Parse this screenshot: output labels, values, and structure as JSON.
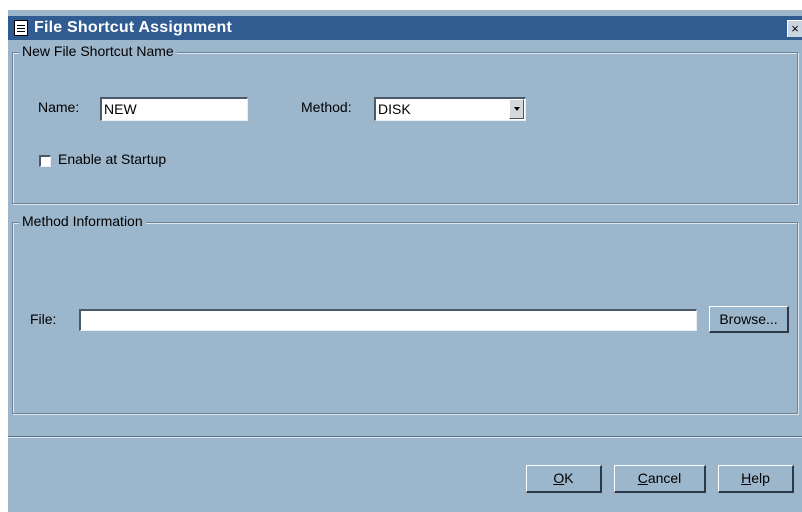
{
  "window": {
    "title": "File Shortcut Assignment",
    "close_label": "×"
  },
  "new_shortcut_group": {
    "legend": "New File Shortcut Name",
    "name_label": "Name:",
    "name_value": "NEW",
    "method_label": "Method:",
    "method_value": "DISK",
    "enable_startup_label": "Enable at Startup",
    "enable_startup_checked": false
  },
  "method_info_group": {
    "legend": "Method Information",
    "file_label": "File:",
    "file_value": "",
    "browse_label": "Browse..."
  },
  "buttons": {
    "ok_mnemonic": "O",
    "ok_rest": "K",
    "cancel_mnemonic": "C",
    "cancel_rest": "ancel",
    "help_mnemonic": "H",
    "help_rest": "elp"
  },
  "colors": {
    "dialog_background": "#9cb6cc",
    "titlebar": "#305c92"
  },
  "icons": [
    "window-document-icon",
    "close-icon",
    "dropdown-arrow-icon"
  ]
}
